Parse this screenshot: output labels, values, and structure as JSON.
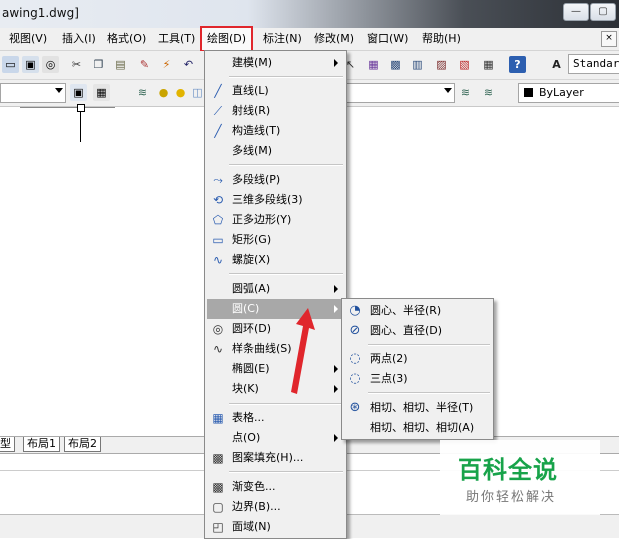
{
  "window": {
    "title": "awing1.dwg]",
    "controls": [
      "—",
      "▢"
    ]
  },
  "menubar": {
    "items": [
      "视图(V)",
      "插入(I)",
      "格式(O)",
      "工具(T)",
      "绘图(D)",
      "标注(N)",
      "修改(M)",
      "窗口(W)",
      "帮助(H)"
    ],
    "active_index": 4,
    "mdi_close": "×"
  },
  "toolbar": {
    "text_style": "Standar",
    "layer_color": "ByLayer"
  },
  "layout_tabs": [
    "型",
    "布局1",
    "布局2"
  ],
  "draw_menu": {
    "groups": [
      [
        {
          "label": "建模(M)",
          "icon": "modeling-icon",
          "submenu": true
        }
      ],
      [
        {
          "label": "直线(L)",
          "icon": "line-icon"
        },
        {
          "label": "射线(R)",
          "icon": "ray-icon"
        },
        {
          "label": "构造线(T)",
          "icon": "construction-line-icon"
        },
        {
          "label": "多线(M)",
          "icon": ""
        }
      ],
      [
        {
          "label": "多段线(P)",
          "icon": "polyline-icon"
        },
        {
          "label": "三维多段线(3)",
          "icon": "3d-polyline-icon"
        },
        {
          "label": "正多边形(Y)",
          "icon": "polygon-icon"
        },
        {
          "label": "矩形(G)",
          "icon": "rectangle-icon"
        },
        {
          "label": "螺旋(X)",
          "icon": "helix-icon"
        }
      ],
      [
        {
          "label": "圆弧(A)",
          "icon": "",
          "submenu": true
        },
        {
          "label": "圆(C)",
          "icon": "",
          "submenu": true,
          "highlighted": true
        },
        {
          "label": "圆环(D)",
          "icon": "donut-icon"
        },
        {
          "label": "样条曲线(S)",
          "icon": "spline-icon"
        },
        {
          "label": "椭圆(E)",
          "icon": "",
          "submenu": true
        },
        {
          "label": "块(K)",
          "icon": "",
          "submenu": true
        }
      ],
      [
        {
          "label": "表格...",
          "icon": "table-icon"
        },
        {
          "label": "点(O)",
          "icon": "",
          "submenu": true
        },
        {
          "label": "图案填充(H)...",
          "icon": "hatch-icon"
        }
      ],
      [
        {
          "label": "渐变色...",
          "icon": "gradient-icon"
        },
        {
          "label": "边界(B)...",
          "icon": "boundary-icon"
        },
        {
          "label": "面域(N)",
          "icon": "region-icon"
        }
      ]
    ]
  },
  "circle_submenu": {
    "groups": [
      [
        {
          "label": "圆心、半径(R)",
          "icon": "center-radius-icon"
        },
        {
          "label": "圆心、直径(D)",
          "icon": "center-diameter-icon"
        }
      ],
      [
        {
          "label": "两点(2)",
          "icon": "two-point-icon"
        },
        {
          "label": "三点(3)",
          "icon": "three-point-icon"
        }
      ],
      [
        {
          "label": "相切、相切、半径(T)",
          "icon": "tan-tan-radius-icon"
        },
        {
          "label": "相切、相切、相切(A)",
          "icon": ""
        }
      ]
    ]
  },
  "watermark": {
    "title": "百科全说",
    "subtitle": "助你轻松解决"
  },
  "colors": {
    "highlight": "#a8a8a8",
    "annotation_red": "#e0262c",
    "watermark_green": "#18a34a"
  }
}
